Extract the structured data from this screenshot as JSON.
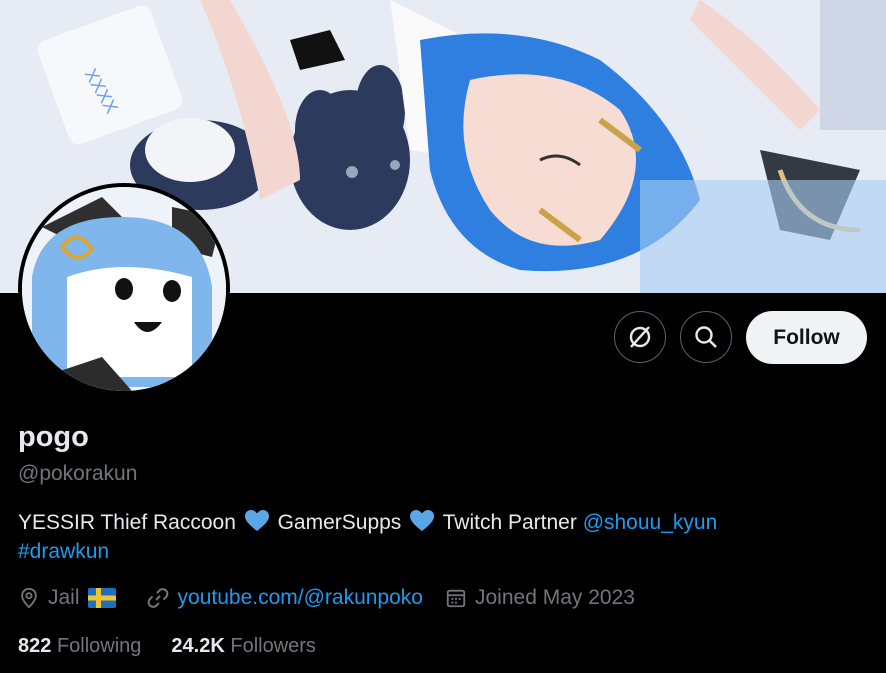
{
  "banner": {
    "description_icon": "banner-art"
  },
  "actions": {
    "more_icon": "grok-slash-icon",
    "search_icon": "search-icon",
    "follow_label": "Follow"
  },
  "profile": {
    "display_name": "pogo",
    "handle": "@pokorakun",
    "bio": {
      "part1": "YESSIR Thief Raccoon",
      "part2": "GamerSupps",
      "part3": "Twitch Partner",
      "mention": "@shouu_kyun",
      "hashtag": "#drawkun"
    },
    "location": "Jail",
    "website": "youtube.com/@rakunpoko",
    "joined": "Joined May 2023"
  },
  "stats": {
    "following_count": "822",
    "following_label": "Following",
    "followers_count": "24.2K",
    "followers_label": "Followers"
  },
  "colors": {
    "background": "#000000",
    "text": "#e7e9ea",
    "muted": "#71767b",
    "link": "#1d9bf0",
    "heart": "#5aa7e8"
  }
}
